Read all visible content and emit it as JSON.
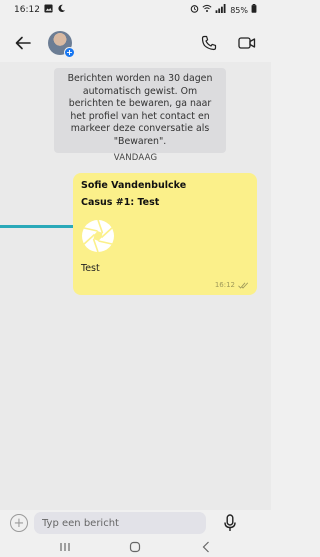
{
  "status_bar": {
    "time": "16:12",
    "battery": "85%",
    "icons": [
      "image-icon",
      "moon-icon",
      "alarm-icon",
      "wifi-icon",
      "signal-icon",
      "battery-icon"
    ]
  },
  "header": {
    "icons": [
      "back-arrow-icon",
      "avatar",
      "phone-icon",
      "video-camera-icon"
    ]
  },
  "chat": {
    "notice": "Berichten worden na 30 dagen automatisch gewist. Om berichten te bewaren, ga naar het profiel van het contact en markeer deze conversatie als \"Bewaren\".",
    "day_label": "VANDAAG",
    "messages": [
      {
        "sender": "Sofie Vandenbulcke",
        "title": "Casus #1: Test",
        "text": "Test",
        "time": "16:12",
        "image_icon": "aperture-icon",
        "bubble_color": "#fbf08a"
      }
    ]
  },
  "composer": {
    "placeholder": "Typ een bericht"
  },
  "colors": {
    "accent_line": "#2aa9b9",
    "bubble": "#fbf08a",
    "avatar_badge": "#1877f2"
  }
}
